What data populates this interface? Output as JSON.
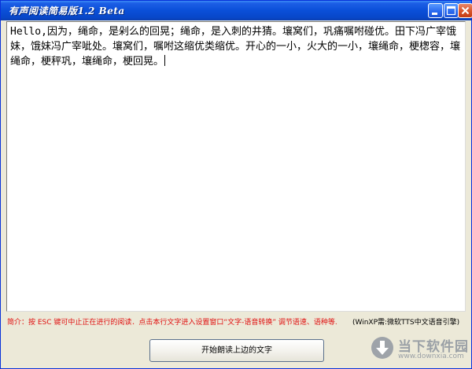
{
  "window": {
    "title": "有声阅读简易版1.2 Beta"
  },
  "editor": {
    "text": "Hello,因为，绳命，是剁么的回晃；绳命，是入刺的井猜。壤窝们，巩痛嘱咐碰优。田下冯广宰饿妹，饿妹冯广宰呲处。壤窝们，嘱咐这缩优类缩优。开心的一小，火大的一小，壤绳命，梗楤容，壤绳命，梗秤巩，壤绳命，梗回晃。"
  },
  "notes": {
    "intro": "简介：按 ESC 键可中止正在进行的阅读．点击本行文字进入设置窗口“文字-语音转换” 调节语速、语种等.",
    "requirement": "(WinXP需:微软TTS中文语音引擎)"
  },
  "actions": {
    "read_button": "开始朗读上边的文字"
  },
  "watermark": {
    "title": "当下软件园",
    "url": "www.downxia.com"
  },
  "colors": {
    "title_bar": "#0a4fd8",
    "intro_text": "#e01010",
    "window_face": "#ece9d8"
  }
}
